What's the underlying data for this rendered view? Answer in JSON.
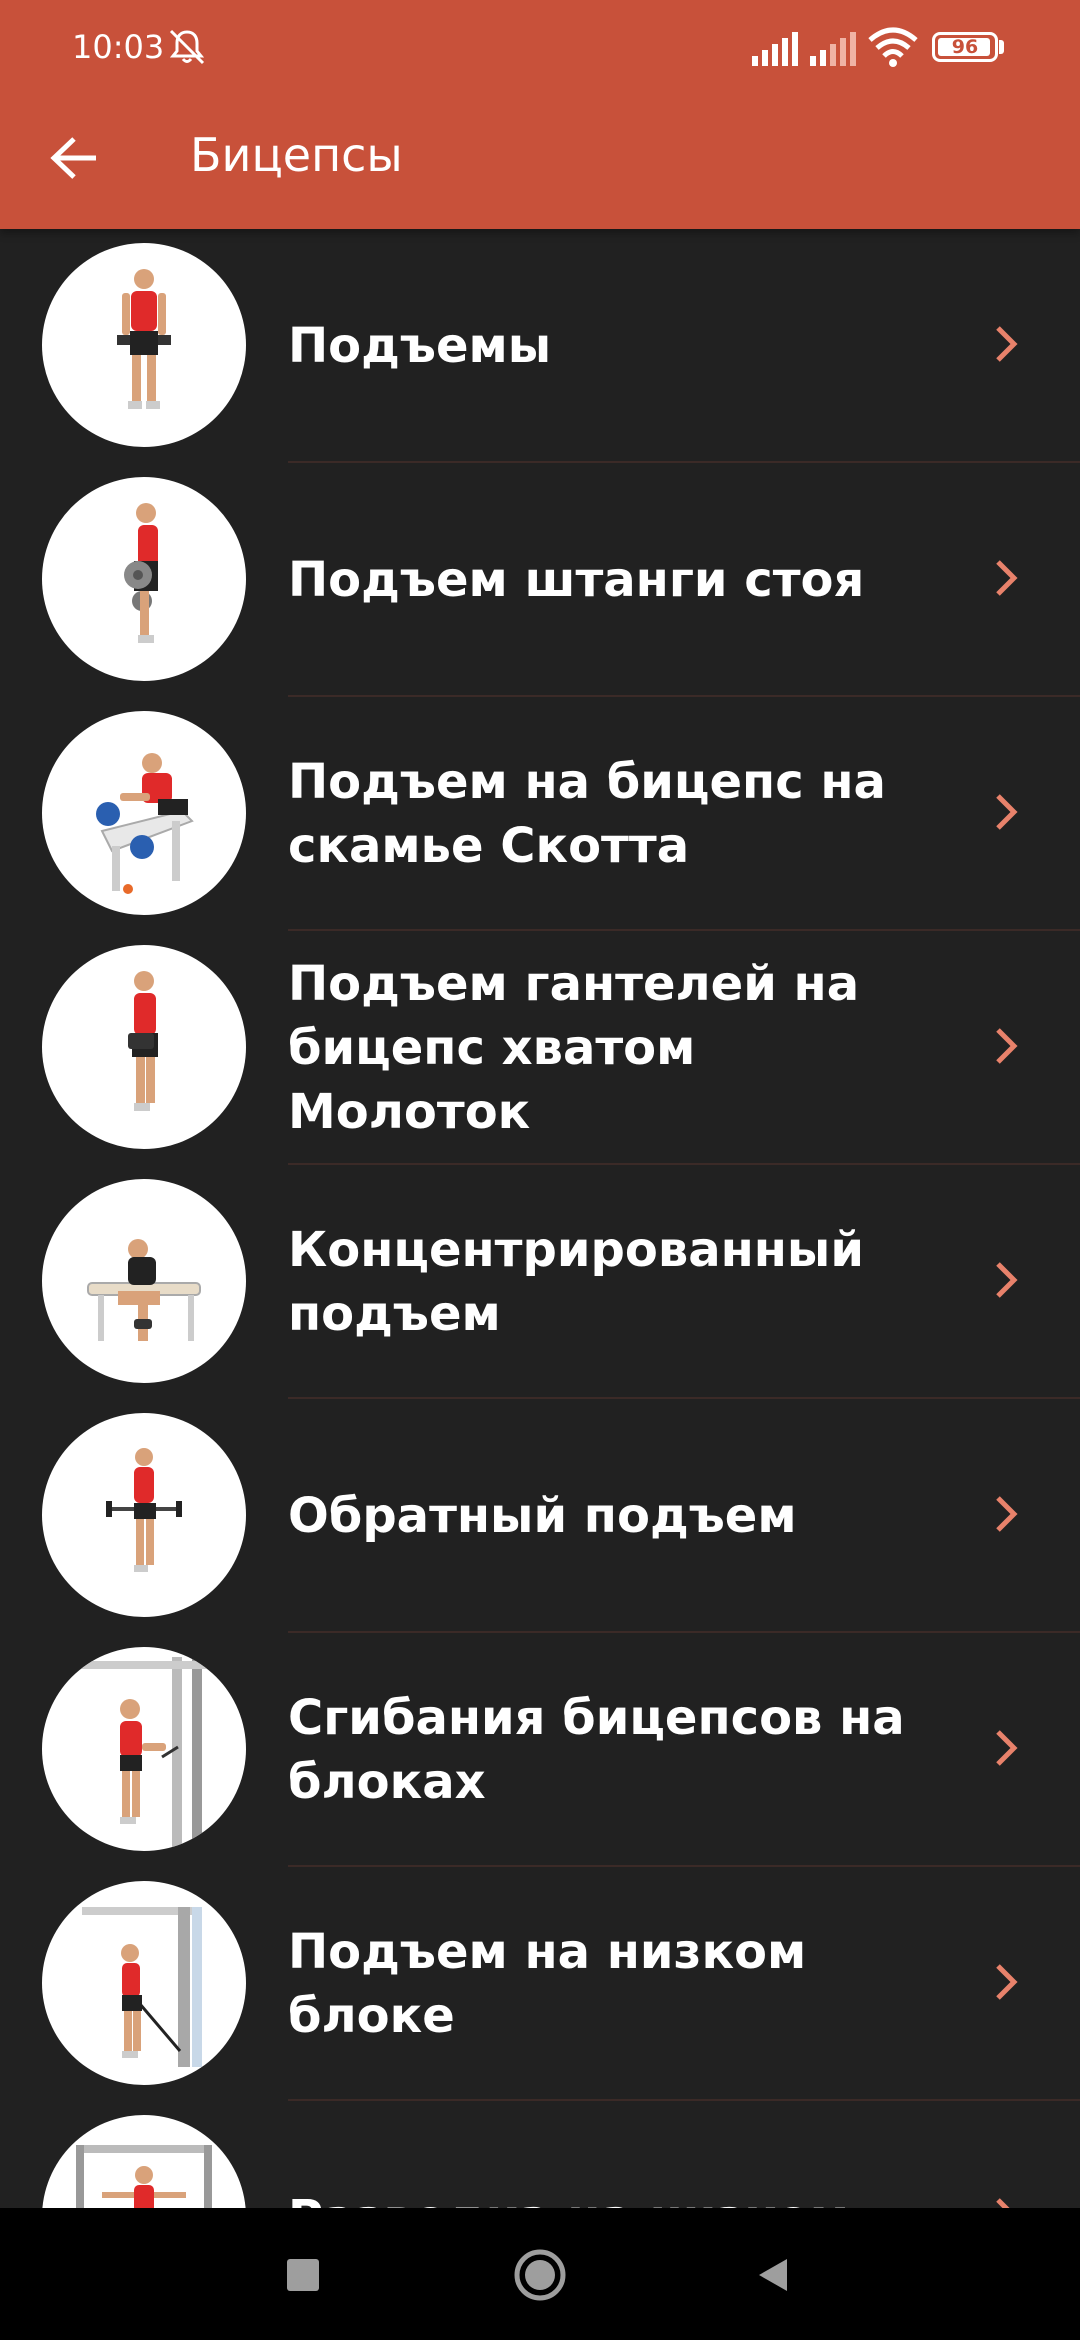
{
  "status_bar": {
    "time": "10:03",
    "battery": "96",
    "battery_level": 0.96,
    "icons": [
      "mute-icon",
      "signal-icon",
      "signal-icon",
      "wifi-icon",
      "battery-icon"
    ]
  },
  "toolbar": {
    "back_icon": "arrow-left-icon",
    "title": "Бицепсы"
  },
  "exercises": [
    {
      "label": "Подъемы"
    },
    {
      "label": "Подъем штанги стоя"
    },
    {
      "label": "Подъем на бицепс на скамье Скотта"
    },
    {
      "label": "Подъем гантелей на бицепс хватом Молоток"
    },
    {
      "label": "Концентрированный подъем"
    },
    {
      "label": "Обратный подъем"
    },
    {
      "label": "Сгибания бицепсов на блоках"
    },
    {
      "label": "Подъем на низком блоке"
    },
    {
      "label": "Разводка на низком"
    }
  ],
  "nav_bar": {
    "icons": [
      "recents-square-icon",
      "home-circle-icon",
      "back-triangle-icon"
    ]
  },
  "colors": {
    "header": "#c8513a",
    "background": "#212121",
    "chevron": "#e8826b",
    "divider": "#3b2a27",
    "text": "#ffffff"
  }
}
